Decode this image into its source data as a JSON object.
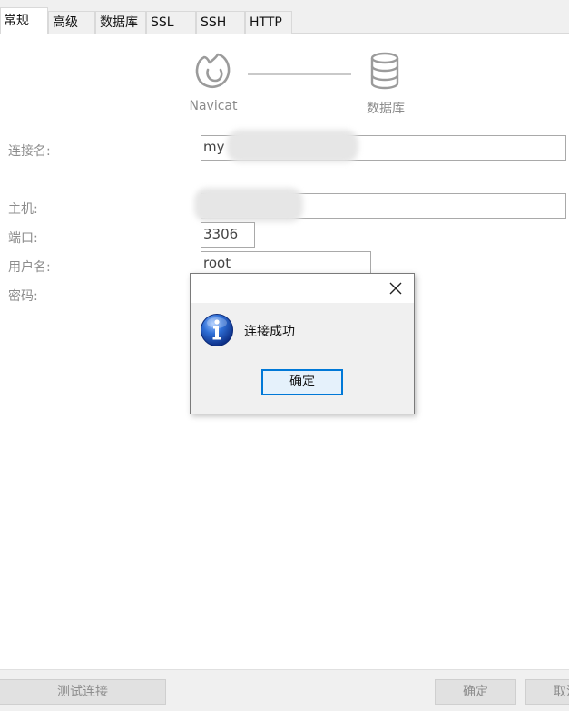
{
  "tabs": [
    {
      "label": "常规",
      "active": true
    },
    {
      "label": "高级"
    },
    {
      "label": "数据库"
    },
    {
      "label": "SSL"
    },
    {
      "label": "SSH"
    },
    {
      "label": "HTTP"
    }
  ],
  "diagram": {
    "left_label": "Navicat",
    "right_label": "数据库",
    "left_icon": "navicat-logo-icon",
    "right_icon": "database-icon"
  },
  "form": {
    "connection_name_label": "连接名:",
    "connection_name_value": "my",
    "host_label": "主机:",
    "host_value": "",
    "port_label": "端口:",
    "port_value": "3306",
    "user_label": "用户名:",
    "user_value": "root",
    "password_label": "密码:"
  },
  "footer": {
    "test_button": "测试连接",
    "ok_button": "确定",
    "cancel_button": "取消"
  },
  "dialog": {
    "icon": "info-icon",
    "message": "连接成功",
    "ok_button": "确定"
  },
  "colors": {
    "accent": "#0078d7",
    "label_gray": "#8c8c8c",
    "info_blue": "#1a4fb5"
  }
}
